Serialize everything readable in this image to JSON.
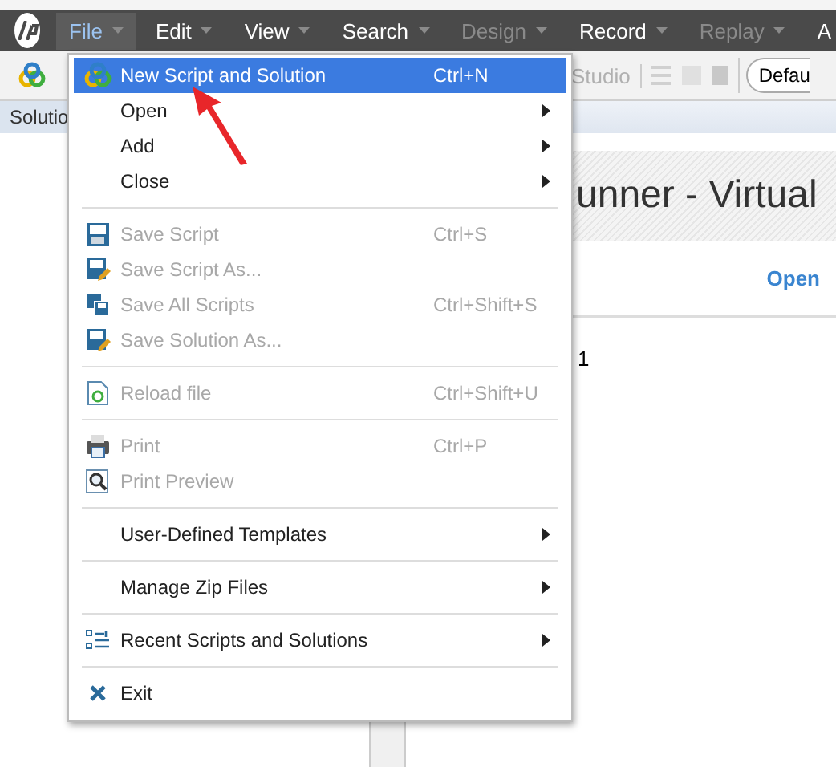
{
  "menubar": [
    {
      "label": "File",
      "selected": true,
      "disabled": false,
      "caret": true
    },
    {
      "label": "Edit",
      "selected": false,
      "disabled": false,
      "caret": true
    },
    {
      "label": "View",
      "selected": false,
      "disabled": false,
      "caret": true
    },
    {
      "label": "Search",
      "selected": false,
      "disabled": false,
      "caret": true
    },
    {
      "label": "Design",
      "selected": false,
      "disabled": true,
      "caret": true
    },
    {
      "label": "Record",
      "selected": false,
      "disabled": false,
      "caret": true
    },
    {
      "label": "Replay",
      "selected": false,
      "disabled": true,
      "caret": true
    },
    {
      "label": "A",
      "selected": false,
      "disabled": false,
      "caret": false
    }
  ],
  "toolbar": {
    "studio_label": "Studio",
    "dropdown": "Defau"
  },
  "solution_panel": {
    "title": "Solutio"
  },
  "document": {
    "title": "unner - Virtual",
    "link": "Open",
    "line_number": "1"
  },
  "file_menu": {
    "groups": [
      [
        {
          "kind": "new",
          "label": "New Script and Solution",
          "shortcut": "Ctrl+N",
          "submenu": false,
          "disabled": false,
          "selected": true
        },
        {
          "kind": "plain",
          "label": "Open",
          "submenu": true,
          "disabled": false,
          "selected": false
        },
        {
          "kind": "plain",
          "label": "Add",
          "submenu": true,
          "disabled": false,
          "selected": false
        },
        {
          "kind": "plain",
          "label": "Close",
          "submenu": true,
          "disabled": false,
          "selected": false
        }
      ],
      [
        {
          "kind": "save",
          "label": "Save Script",
          "shortcut": "Ctrl+S",
          "submenu": false,
          "disabled": true,
          "selected": false
        },
        {
          "kind": "save-as",
          "label": "Save Script As...",
          "submenu": false,
          "disabled": true,
          "selected": false
        },
        {
          "kind": "save-all",
          "label": "Save All Scripts",
          "shortcut": "Ctrl+Shift+S",
          "submenu": false,
          "disabled": true,
          "selected": false
        },
        {
          "kind": "save-as",
          "label": "Save Solution As...",
          "submenu": false,
          "disabled": true,
          "selected": false
        }
      ],
      [
        {
          "kind": "reload",
          "label": "Reload file",
          "shortcut": "Ctrl+Shift+U",
          "submenu": false,
          "disabled": true,
          "selected": false
        }
      ],
      [
        {
          "kind": "print",
          "label": "Print",
          "shortcut": "Ctrl+P",
          "submenu": false,
          "disabled": true,
          "selected": false
        },
        {
          "kind": "preview",
          "label": "Print Preview",
          "submenu": false,
          "disabled": true,
          "selected": false
        }
      ],
      [
        {
          "kind": "plain",
          "label": "User-Defined Templates",
          "submenu": true,
          "disabled": false,
          "selected": false
        }
      ],
      [
        {
          "kind": "plain",
          "label": "Manage Zip Files",
          "submenu": true,
          "disabled": false,
          "selected": false
        }
      ],
      [
        {
          "kind": "recent",
          "label": "Recent Scripts and Solutions",
          "submenu": true,
          "disabled": false,
          "selected": false
        }
      ],
      [
        {
          "kind": "exit",
          "label": "Exit",
          "submenu": false,
          "disabled": false,
          "selected": false
        }
      ]
    ]
  }
}
